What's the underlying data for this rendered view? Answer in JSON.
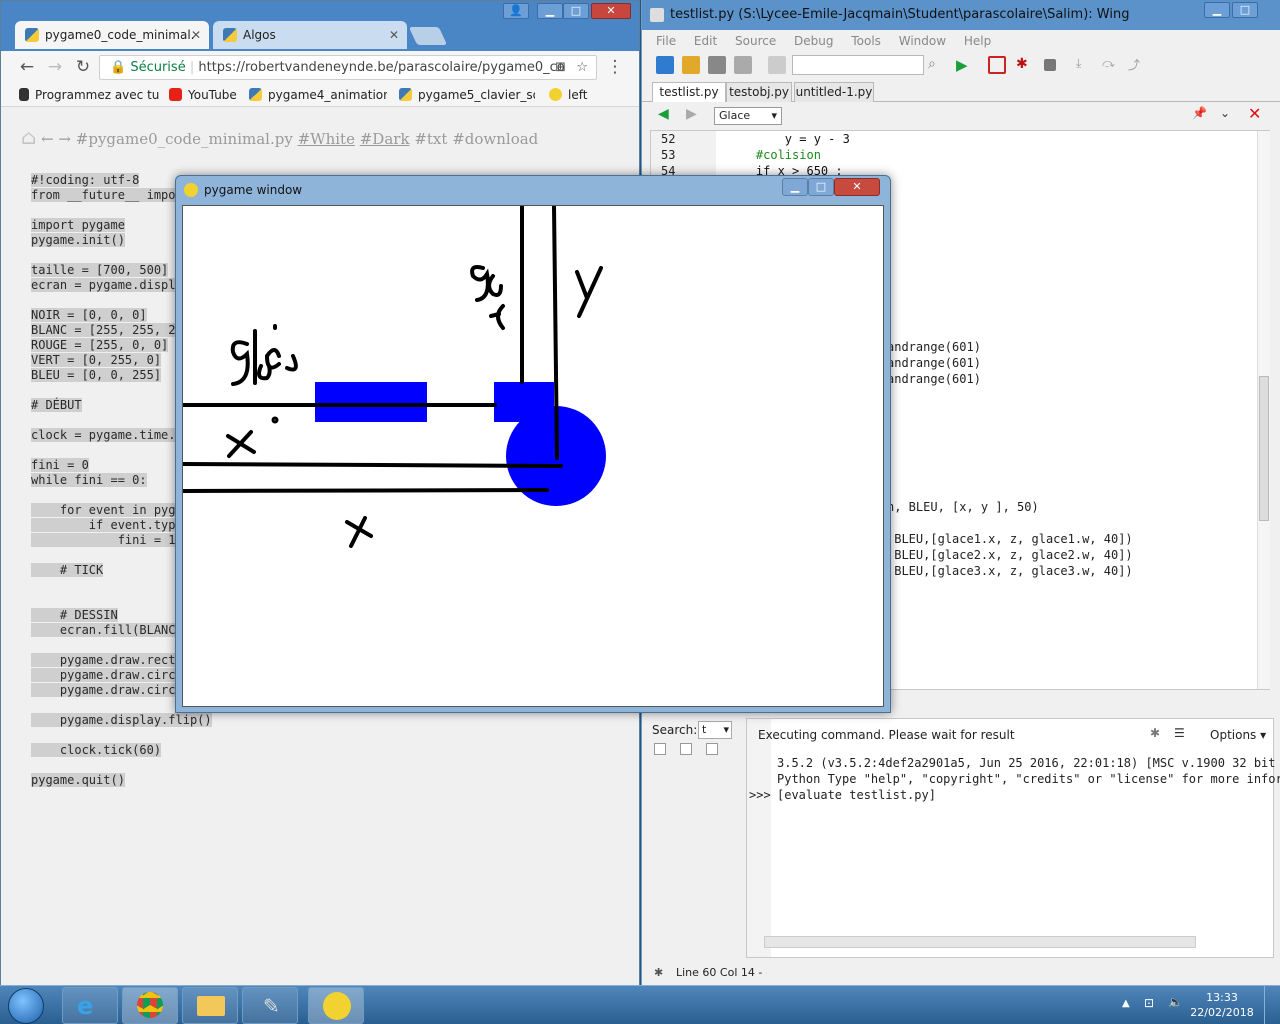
{
  "chrome": {
    "tabs": [
      {
        "title": "pygame0_code_minimal.",
        "active": true
      },
      {
        "title": "Algos",
        "active": false
      }
    ],
    "secure_label": "Sécurisé",
    "url": "https://robertvandeneynde.be/parascolaire/pygame0_co",
    "bookmarks": [
      "Programmez avec tur",
      "YouTube",
      "pygame4_animations",
      "pygame5_clavier_sour",
      "left"
    ],
    "page_nav": {
      "title": "#pygame0_code_minimal.py",
      "white": "#White",
      "dark": "#Dark",
      "txt": "#txt",
      "download": "#download"
    },
    "code_lines": [
      "#!coding: utf-8",
      "from __future__ impo",
      "",
      "import pygame",
      "pygame.init()",
      "",
      "taille = [700, 500]",
      "ecran = pygame.displ",
      "",
      "NOIR = [0, 0, 0]",
      "BLANC = [255, 255, 2",
      "ROUGE = [255, 0, 0]",
      "VERT = [0, 255, 0]",
      "BLEU = [0, 0, 255]",
      "",
      "# DÉBUT",
      "",
      "clock = pygame.time.",
      "",
      "fini = 0",
      "while fini == 0:",
      "",
      "    for event in pyg",
      "        if event.typ",
      "            fini = 1",
      "",
      "    # TICK",
      "",
      "",
      "    # DESSIN",
      "    ecran.fill(BLANC",
      "",
      "    pygame.draw.rect",
      "    pygame.draw.circ",
      "    pygame.draw.circ",
      "",
      "    pygame.display.flip()",
      "",
      "    clock.tick(60)",
      "",
      "pygame.quit()"
    ]
  },
  "wing": {
    "title": "testlist.py (S:\\Lycee-Emile-Jacqmain\\Student\\parascolaire\\Salim): Wing",
    "menu": [
      "File",
      "Edit",
      "Source",
      "Debug",
      "Tools",
      "Window",
      "Help"
    ],
    "tabs": [
      "testlist.py",
      "testobj.py",
      "untitled-1.py"
    ],
    "scope_select": "Glace",
    "editor_lines": [
      {
        "num": "52",
        "text": "        y = y - 3"
      },
      {
        "num": "53",
        "text": "    #colision"
      },
      {
        "num": "54",
        "text": "    if x > 650 :"
      }
    ],
    "right_fragments": [
      "andrange(601)",
      "andrange(601)",
      "andrange(601)",
      "n, BLEU, [x, y ], 50)",
      " BLEU,[glace1.x, z, glace1.w, 40])",
      " BLEU,[glace2.x, z, glace2.w, 40])",
      " BLEU,[glace3.x, z, glace3.w, 40])"
    ],
    "search_label": "Search:",
    "search_value": "t",
    "shell_status": "Executing command.  Please wait for result",
    "options_label": "Options",
    "shell_lines": [
      "3.5.2 (v3.5.2:4def2a2901a5, Jun 25 2016, 22:01:18) [MSC v.1900 32 bit",
      "Python Type \"help\", \"copyright\", \"credits\" or \"license\" for more infor",
      "[evaluate testlist.py]"
    ],
    "prompt": ">>>",
    "status": "Line 60 Col 14 -"
  },
  "pygame": {
    "title": "pygame window",
    "handwriting": [
      "glace",
      "glace",
      "x",
      "x",
      "y"
    ]
  },
  "taskbar": {
    "time": "13:33",
    "date": "22/02/2018"
  },
  "colors": {
    "pygame_blue": "#0000ff",
    "titlebar": "#4a86c6"
  }
}
